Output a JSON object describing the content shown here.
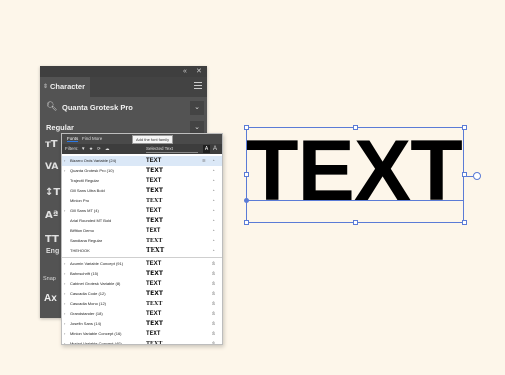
{
  "panel": {
    "title": "Character",
    "collapse_glyph": "«",
    "close_glyph": "✕",
    "font_family": "Quanta Grotesk Pro",
    "font_style": "Regular",
    "side_labels": [
      "Eng",
      "Snap",
      "Ax"
    ]
  },
  "font_list": {
    "tabs": [
      "Fonts",
      "Find More"
    ],
    "tooltip": "Add the font family",
    "filters_label": "Filters:",
    "selected_text_label": "Selected Text",
    "size_large": "A",
    "size_small": "A",
    "rows": [
      {
        "name": "Bizarro Ords Variable (24)",
        "preview": "TEXT",
        "selected": true,
        "expandable": true
      },
      {
        "name": "Quanta Grotesk Pro (10)",
        "preview": "TEXT",
        "expandable": true
      },
      {
        "name": "Trajectil Regular",
        "preview": "TEXT",
        "expandable": false
      },
      {
        "name": "Gill Sans Ultra Bold",
        "preview": "TEXT",
        "expandable": false
      },
      {
        "name": "Minion Pro",
        "preview": "TEXT",
        "expandable": false
      },
      {
        "name": "Gill Sans MT (4)",
        "preview": "TEXT",
        "expandable": true
      },
      {
        "name": "Arial Rounded MT Bold",
        "preview": "TEXT",
        "expandable": false
      },
      {
        "name": "Biffiton Demo",
        "preview": "TEXT",
        "expandable": false
      },
      {
        "name": "Sandiana Regular",
        "preview": "TEXT",
        "expandable": false
      },
      {
        "name": "THEHOOK",
        "preview": "TEXT",
        "expandable": false
      },
      {
        "name": "Acumin Variable Concept (91)",
        "preview": "TEXT",
        "expandable": true,
        "separator_before": true
      },
      {
        "name": "Bahnschrift (15)",
        "preview": "TEXT",
        "expandable": true
      },
      {
        "name": "Cabinet Grotesk Variable (8)",
        "preview": "TEXT",
        "expandable": true
      },
      {
        "name": "Cascadia Code (12)",
        "preview": "TEXT",
        "expandable": true
      },
      {
        "name": "Cascadia Mono (12)",
        "preview": "TEXT",
        "expandable": true
      },
      {
        "name": "Grandstander (18)",
        "preview": "TEXT",
        "expandable": true
      },
      {
        "name": "Josefin Sans (14)",
        "preview": "TEXT",
        "expandable": true
      },
      {
        "name": "Minion Variable Concept (16)",
        "preview": "TEXT",
        "expandable": true
      },
      {
        "name": "Myriad Variable Concept (40)",
        "preview": "TEXT",
        "expandable": true
      }
    ]
  },
  "canvas": {
    "text": "TEXT"
  },
  "colors": {
    "background": "#fdf6ea",
    "panel": "#535353",
    "selection": "#5b7bd6"
  }
}
